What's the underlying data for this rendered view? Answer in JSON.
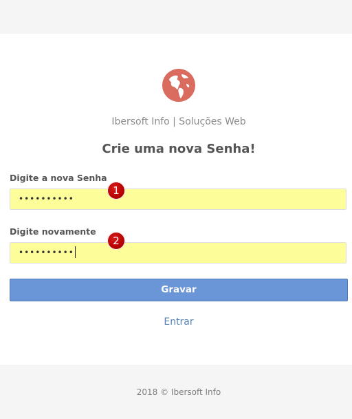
{
  "brand": {
    "name": "Ibersoft Info | Soluções Web",
    "accent_color": "#d96b5f"
  },
  "heading": "Crie uma nova Senha!",
  "form": {
    "new_password": {
      "label": "Digite a nova Senha",
      "value": "••••••••••",
      "badge": "1"
    },
    "confirm_password": {
      "label": "Digite novamente",
      "value": "••••••••••",
      "badge": "2"
    },
    "submit_label": "Gravar",
    "input_background": "#fdfd9a",
    "button_color": "#6a95d6"
  },
  "login_link": "Entrar",
  "footer": {
    "copyright": "2018 © Ibersoft Info"
  }
}
